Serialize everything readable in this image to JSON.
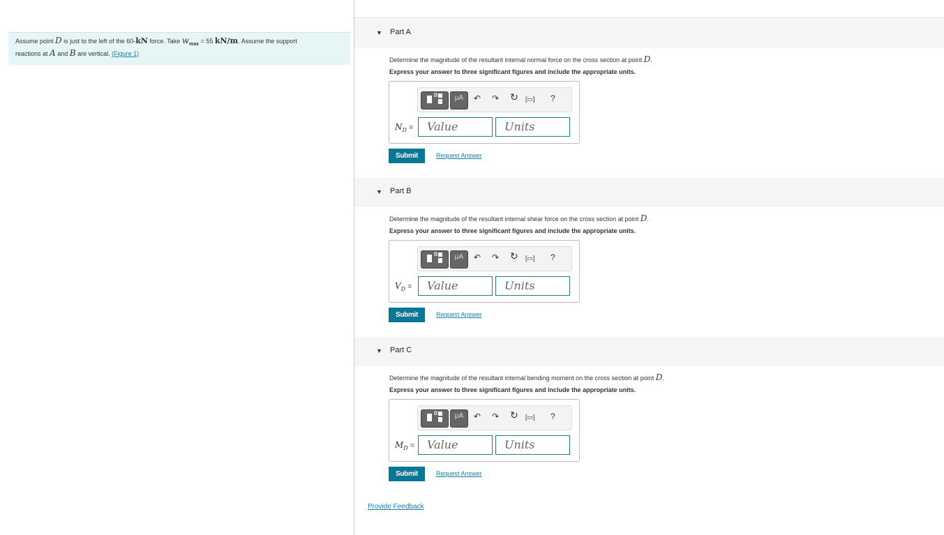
{
  "problem": {
    "t1": "Assume point ",
    "D": "D",
    "t2": " is just to the left of the 60-",
    "kN": "kN",
    "t3": " force. Take ",
    "w": "w",
    "wsub": "max",
    "t4": " = 55 ",
    "unit": "kN/m",
    "t5": ". Assume the support",
    "t6": "reactions at ",
    "A": "A",
    "t7": " and ",
    "B": "B",
    "t8": " are vertical. ",
    "link": "(Figure 1)"
  },
  "parts": [
    {
      "title": "Part A",
      "question": "Determine the magnitude of the resultant internal normal force on the cross section at point ",
      "point": "D",
      "instruction": "Express your answer to three significant figures and include the appropriate units.",
      "var": "N",
      "sub": "D",
      "value_placeholder": "Value",
      "units_placeholder": "Units",
      "submit": "Submit",
      "request": "Request Answer"
    },
    {
      "title": "Part B",
      "question": "Determine the magnitude of the resultant internal shear force on the cross section at point ",
      "point": "D",
      "instruction": "Express your answer to three significant figures and include the appropriate units.",
      "var": "V",
      "sub": "D",
      "value_placeholder": "Value",
      "units_placeholder": "Units",
      "submit": "Submit",
      "request": "Request Answer"
    },
    {
      "title": "Part C",
      "question": "Determine the magnitude of the resultant internal bending moment on the cross section at point ",
      "point": "D",
      "instruction": "Express your answer to three significant figures and include the appropriate units.",
      "var": "M",
      "sub": "D",
      "value_placeholder": "Value",
      "units_placeholder": "Units",
      "submit": "Submit",
      "request": "Request Answer"
    }
  ],
  "toolbar": {
    "mu": "μA",
    "help": "?"
  },
  "feedback": "Provide Feedback"
}
